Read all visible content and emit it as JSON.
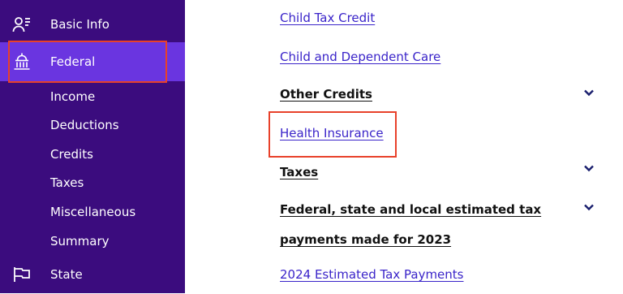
{
  "sidebar": {
    "basic_info": "Basic Info",
    "federal": "Federal",
    "sub_items": [
      "Income",
      "Deductions",
      "Credits",
      "Taxes",
      "Miscellaneous",
      "Summary"
    ],
    "state": "State"
  },
  "main": {
    "child_tax_credit": "Child Tax Credit",
    "child_dependent_care": "Child and Dependent Care",
    "other_credits": "Other Credits",
    "health_insurance": "Health Insurance",
    "taxes": "Taxes",
    "estimated_tax_line1": "Federal, state and local estimated tax",
    "estimated_tax_line2": "payments made for 2023",
    "estimated_payments_2024": "2024 Estimated Tax Payments"
  },
  "colors": {
    "sidebar_bg": "#3b0c7e",
    "active_bg": "#6a35e0",
    "link": "#3a24c9",
    "highlight": "#e8412a"
  },
  "icons": {
    "basic_info": "person-list-icon",
    "federal": "capitol-building-icon",
    "state": "state-flag-icon",
    "expand": "chevron-down-icon"
  }
}
